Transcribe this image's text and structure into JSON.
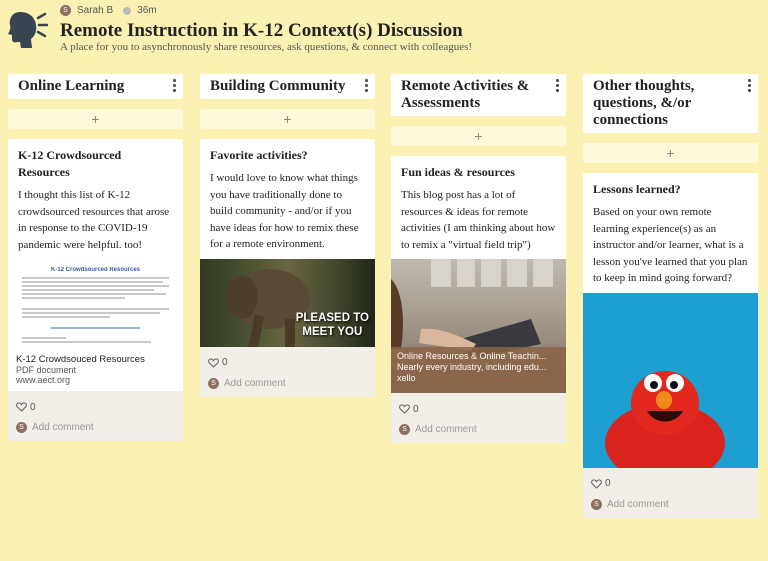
{
  "header": {
    "author": "Sarah B",
    "author_initial": "S",
    "time_ago": "36m",
    "title": "Remote Instruction in K-12 Context(s) Discussion",
    "subtitle": "A place for you to asynchronously share resources, ask questions, & connect with colleagues!"
  },
  "columns": [
    {
      "title": "Online Learning",
      "add_label": "+",
      "card": {
        "title": "K-12 Crowdsourced Resources",
        "text": "I thought this list of K-12 crowdsourced resources that arose in response to the COVID-19 pandemic were helpful. too!",
        "attachment_doc_title": "K-12 Crowdsourced Resources",
        "attachment_title": "K-12 Crowdsouced Resources",
        "attachment_type": "PDF document",
        "attachment_url": "www.aect.org",
        "likes": "0",
        "comment_label": "Add comment"
      }
    },
    {
      "title": "Building Community",
      "add_label": "+",
      "card": {
        "title": "Favorite activities?",
        "text": "I would love to know what things you  have traditionally done to build community - and/or if you have ideas for how to remix these for a remote environment.",
        "image_caption_line1": "PLEASED TO",
        "image_caption_line2": "MEET YOU",
        "likes": "0",
        "comment_label": "Add comment"
      }
    },
    {
      "title": "Remote Activities & Assessments",
      "add_label": "+",
      "card": {
        "title": "Fun ideas & resources",
        "text": "This blog post has a lot of resources & ideas for remote activities (I am thinking about how to remix a \"virtual field trip\")",
        "link_title": "Online Resources & Online Teachin...",
        "link_desc": "Nearly every industry, including edu...",
        "link_site": "xello",
        "likes": "0",
        "comment_label": "Add comment"
      }
    },
    {
      "title": "Other thoughts, questions, &/or connections",
      "add_label": "+",
      "card": {
        "title": "Lessons learned?",
        "text": "Based on your own remote learning experience(s) as an instructor and/or learner, what is a lesson you've learned that you plan to keep in mind going forward?",
        "likes": "0",
        "comment_label": "Add comment"
      }
    }
  ]
}
